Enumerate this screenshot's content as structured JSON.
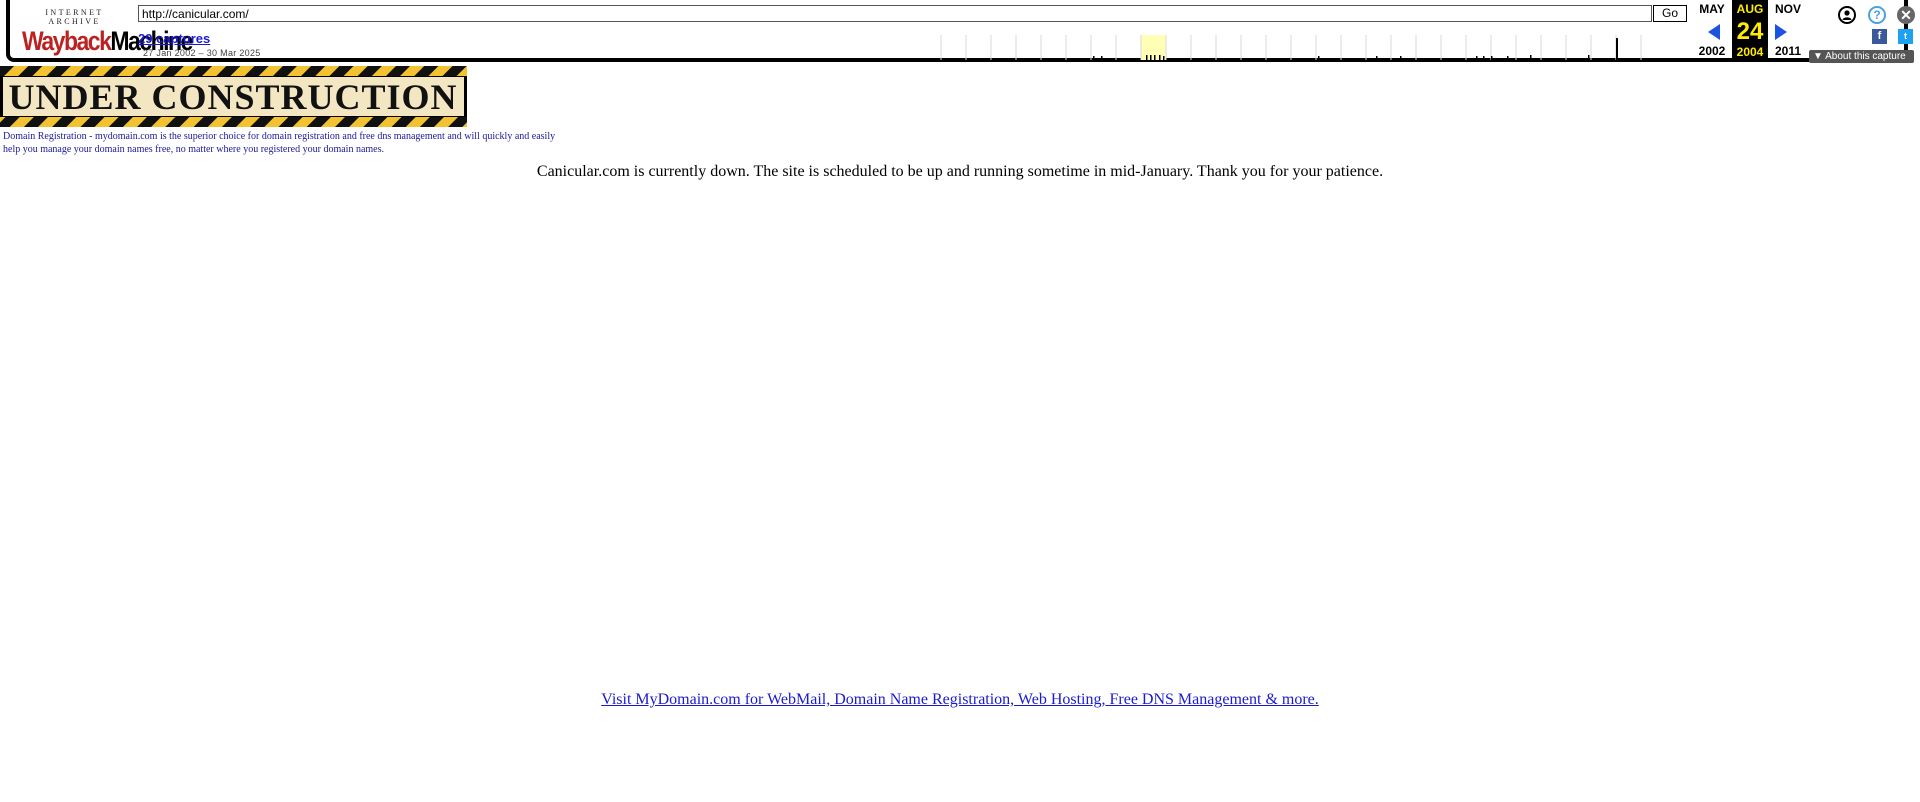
{
  "toolbar": {
    "logo_top": "INTERNET ARCHIVE",
    "logo_bottom_part1": "Wayback",
    "logo_bottom_part2": "Machine",
    "url": "http://canicular.com/",
    "go_label": "Go",
    "captures": "29 captures",
    "range": "27 Jan 2002 – 30 Mar 2025",
    "prev_month": "MAY",
    "prev_year": "2002",
    "cur_month": "AUG",
    "cur_day": "24",
    "cur_year": "2004",
    "next_month": "NOV",
    "next_year": "2011",
    "help_glyph": "?",
    "close_glyph": "✕",
    "fb_glyph": "f",
    "tw_glyph": "t",
    "about": "▼ About this capture",
    "colors": {
      "current_bg": "#000000",
      "current_text": "#ffec00",
      "arrow": "#1b54e0",
      "highlight_year": "#ffffb5"
    }
  },
  "page": {
    "banner_text": "UNDER CONSTRUCTION",
    "reg_prefix": "Domain Registration - ",
    "reg_link": "mydomain.com",
    "reg_suffix": " is the superior choice for domain registration and free dns management and will quickly and easily help you manage your domain names free, no matter where you registered your domain names.",
    "status": "Canicular.com is currently down. The site is scheduled to be up and running sometime in mid-January. Thank you for your patience.",
    "visit_link": "Visit MyDomain.com for WebMail, Domain Name Registration, Web Hosting, Free DNS Management & more."
  }
}
